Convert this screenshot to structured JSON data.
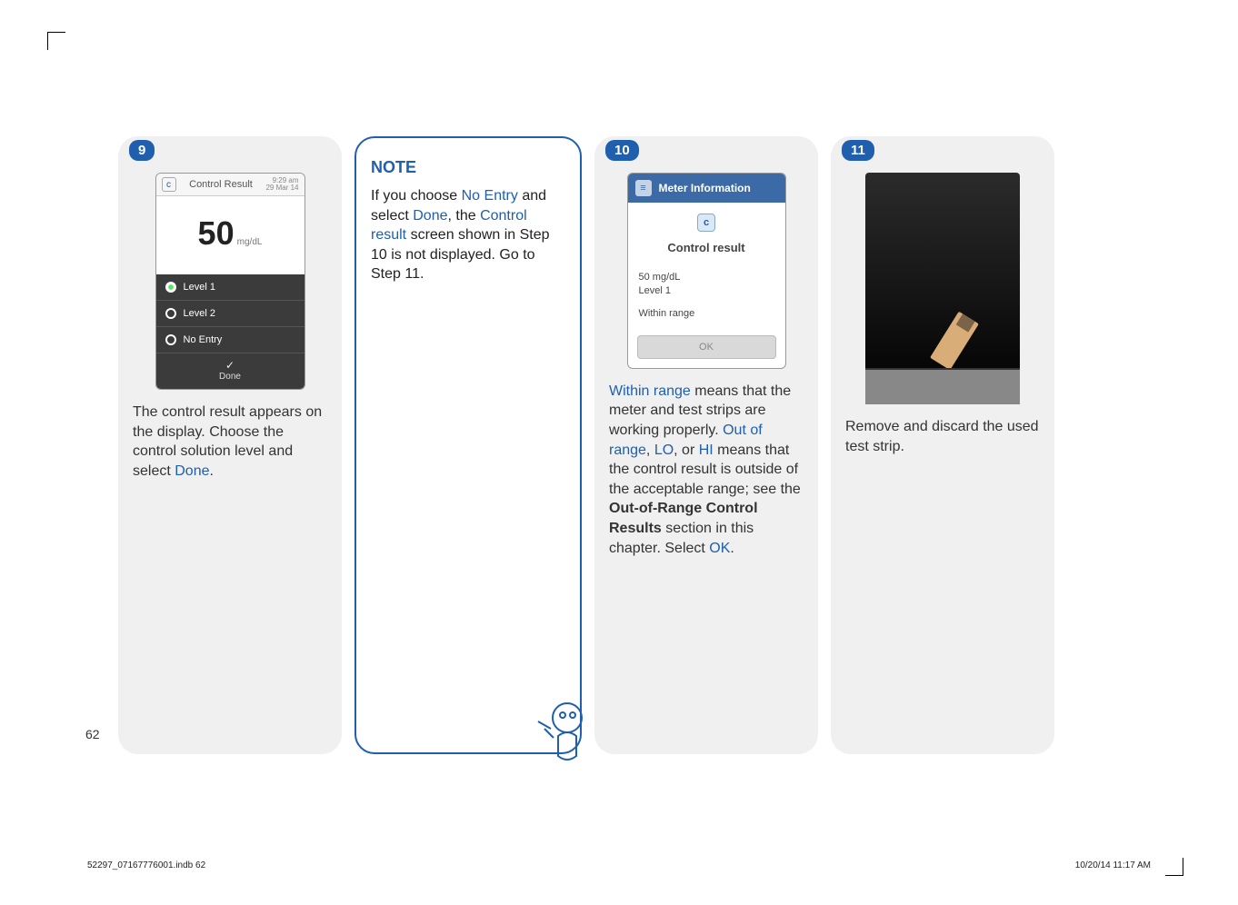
{
  "page_number": "62",
  "footer": {
    "file": "52297_07167776001.indb   62",
    "stamp": "10/20/14   11:17 AM"
  },
  "step9": {
    "badge": "9",
    "phone": {
      "title": "Control Result",
      "time_top": "9:29 am",
      "time_bot": "29 Mar 14",
      "value": "50",
      "unit": "mg/dL",
      "opt1": "Level 1",
      "opt2": "Level 2",
      "opt3": "No Entry",
      "done": "Done"
    },
    "caption_a": "The control result appears on the display. Choose the control solution level and select ",
    "caption_b": "Done",
    "caption_c": "."
  },
  "note": {
    "title": "NOTE",
    "t1": "If you choose ",
    "t2": "No Entry",
    "t3": " and select ",
    "t4": "Done",
    "t5": ", the ",
    "t6": "Control result",
    "t7": " screen shown in Step 10 is not displayed. Go to Step 11."
  },
  "step10": {
    "badge": "10",
    "meter": {
      "header": "Meter Information",
      "subtitle": "Control result",
      "val1": "50 mg/dL",
      "val2": "Level 1",
      "range": "Within range",
      "ok": "OK"
    },
    "c1": "Within range",
    "c2": " means that the meter and test strips are working properly. ",
    "c3": "Out of range",
    "c4": ", ",
    "c5": "LO",
    "c6": ", or ",
    "c7": "HI",
    "c8": " means that the control result is outside of the acceptable range; see the ",
    "c9": "Out-of-Range Control Results",
    "c10": " section in this chapter. Select ",
    "c11": "OK",
    "c12": "."
  },
  "step11": {
    "badge": "11",
    "caption": "Remove and discard the used test strip."
  }
}
